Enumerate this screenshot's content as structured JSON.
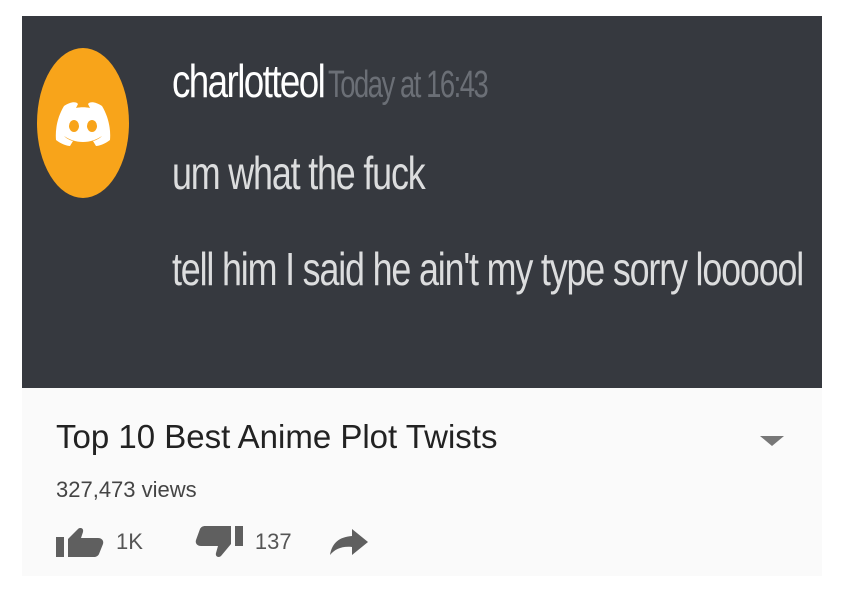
{
  "discord": {
    "username": "charlotteol",
    "timestamp": "Today at 16:43",
    "lines": [
      "um what the fuck",
      "tell him I said he ain't my type sorry loooool"
    ],
    "avatar_icon": "discord-logo-icon",
    "avatar_color": "#f8a41a",
    "background_color": "#36393f"
  },
  "youtube": {
    "title": "Top 10 Best Anime Plot Twists",
    "views": "327,473 views",
    "likes": "1K",
    "dislikes": "137",
    "expand_icon": "chevron-down-icon",
    "like_icon": "thumbs-up-icon",
    "dislike_icon": "thumbs-down-icon",
    "share_icon": "share-arrow-icon"
  }
}
